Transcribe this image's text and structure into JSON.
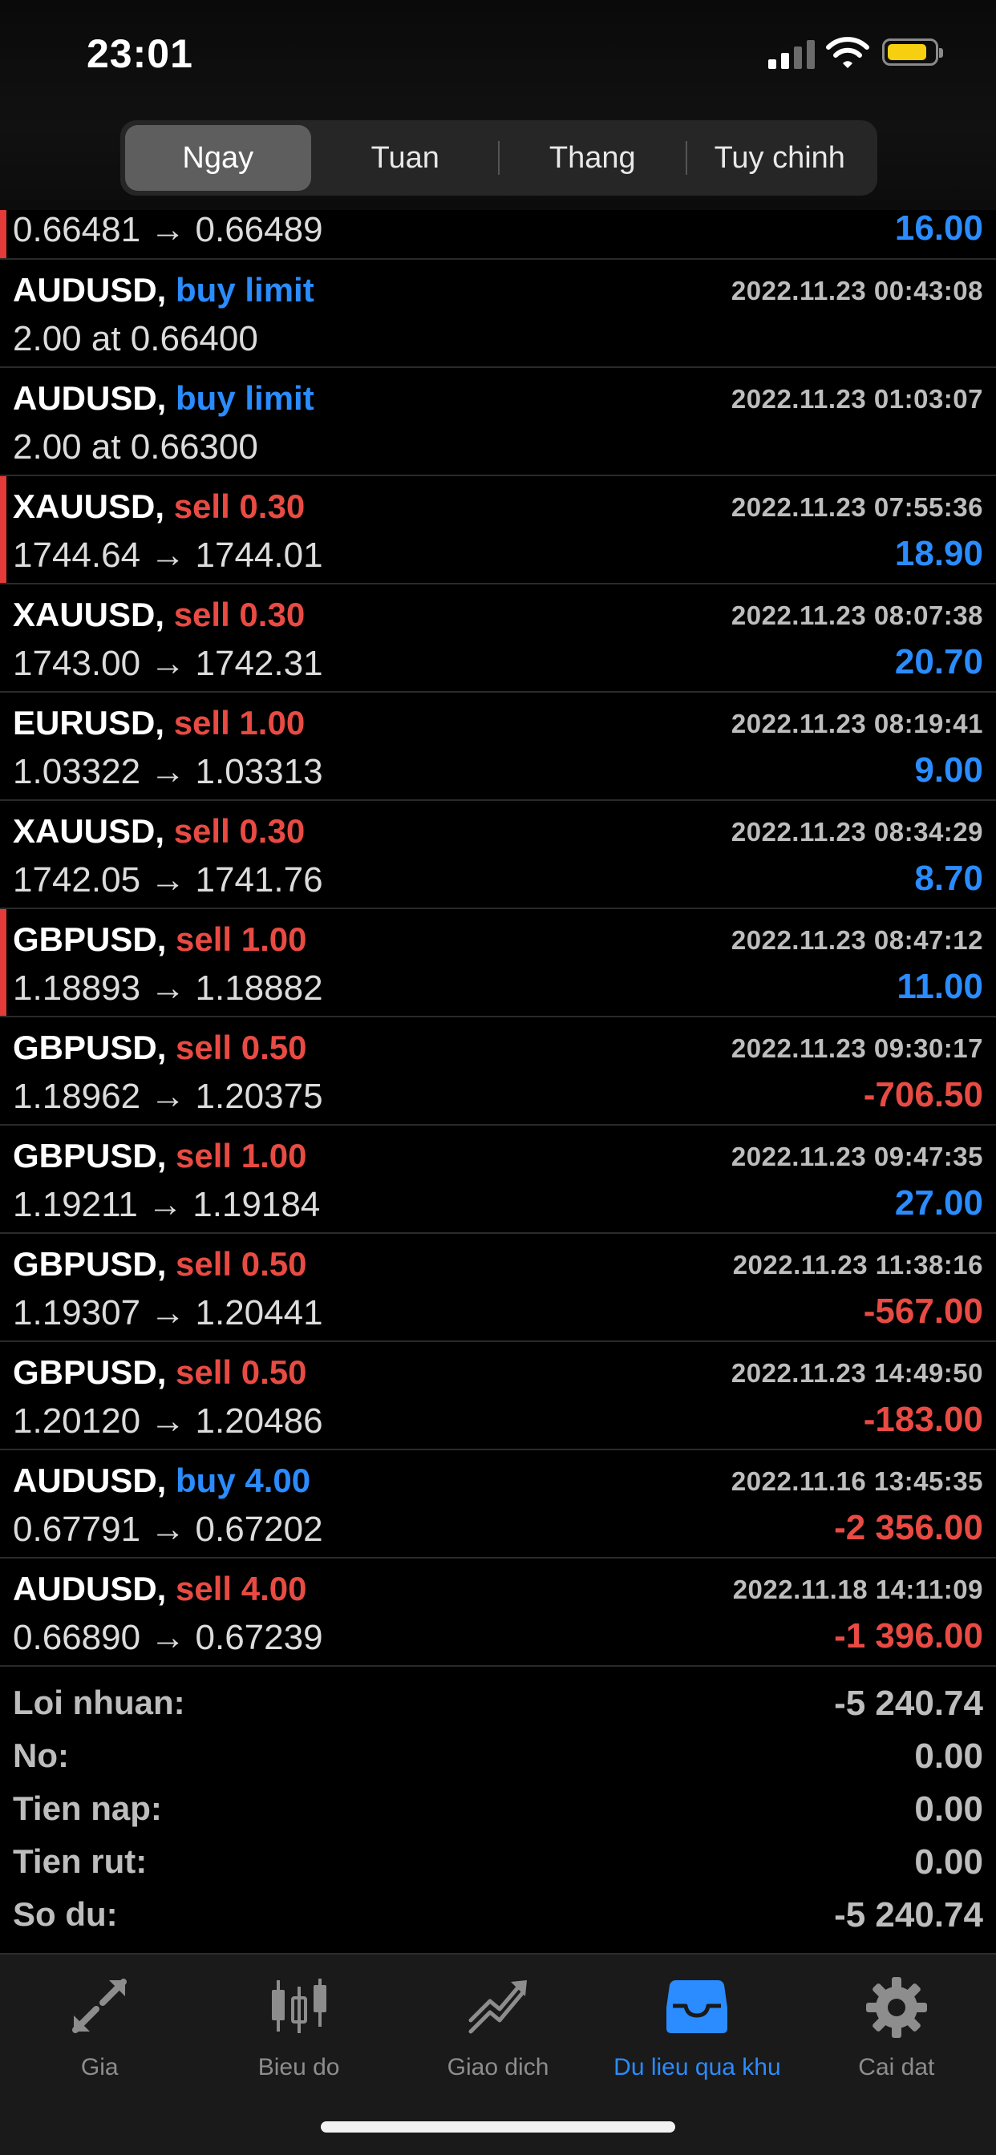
{
  "status_bar": {
    "time": "23:01",
    "battery_color": "#f6d010"
  },
  "segmented": {
    "items": [
      "Ngay",
      "Tuan",
      "Thang",
      "Tuy chinh"
    ],
    "selected": "Ngay"
  },
  "colors": {
    "buy": "#2a8cff",
    "sell": "#e84b43",
    "positive": "#2a8cff",
    "negative": "#e84b43",
    "marker": "#e33a3a"
  },
  "partial_row": {
    "prices": "0.66481 → 0.66489",
    "profit": "16.00"
  },
  "deals": [
    {
      "symbol": "AUDUSD,",
      "type": "buy limit",
      "side": "buy",
      "datetime": "2022.11.23 00:43:08",
      "prices": "2.00 at 0.66400",
      "profit": "",
      "marker": false
    },
    {
      "symbol": "AUDUSD,",
      "type": "buy limit",
      "side": "buy",
      "datetime": "2022.11.23 01:03:07",
      "prices": "2.00 at 0.66300",
      "profit": "",
      "marker": false
    },
    {
      "symbol": "XAUUSD,",
      "type": "sell 0.30",
      "side": "sell",
      "datetime": "2022.11.23 07:55:36",
      "prices": "1744.64 → 1744.01",
      "profit": "18.90",
      "marker": true
    },
    {
      "symbol": "XAUUSD,",
      "type": "sell 0.30",
      "side": "sell",
      "datetime": "2022.11.23 08:07:38",
      "prices": "1743.00 → 1742.31",
      "profit": "20.70",
      "marker": false
    },
    {
      "symbol": "EURUSD,",
      "type": "sell 1.00",
      "side": "sell",
      "datetime": "2022.11.23 08:19:41",
      "prices": "1.03322 → 1.03313",
      "profit": "9.00",
      "marker": false
    },
    {
      "symbol": "XAUUSD,",
      "type": "sell 0.30",
      "side": "sell",
      "datetime": "2022.11.23 08:34:29",
      "prices": "1742.05 → 1741.76",
      "profit": "8.70",
      "marker": false
    },
    {
      "symbol": "GBPUSD,",
      "type": "sell 1.00",
      "side": "sell",
      "datetime": "2022.11.23 08:47:12",
      "prices": "1.18893 → 1.18882",
      "profit": "11.00",
      "marker": true
    },
    {
      "symbol": "GBPUSD,",
      "type": "sell 0.50",
      "side": "sell",
      "datetime": "2022.11.23 09:30:17",
      "prices": "1.18962 → 1.20375",
      "profit": "-706.50",
      "marker": false
    },
    {
      "symbol": "GBPUSD,",
      "type": "sell 1.00",
      "side": "sell",
      "datetime": "2022.11.23 09:47:35",
      "prices": "1.19211 → 1.19184",
      "profit": "27.00",
      "marker": false
    },
    {
      "symbol": "GBPUSD,",
      "type": "sell 0.50",
      "side": "sell",
      "datetime": "2022.11.23 11:38:16",
      "prices": "1.19307 → 1.20441",
      "profit": "-567.00",
      "marker": false
    },
    {
      "symbol": "GBPUSD,",
      "type": "sell 0.50",
      "side": "sell",
      "datetime": "2022.11.23 14:49:50",
      "prices": "1.20120 → 1.20486",
      "profit": "-183.00",
      "marker": false
    },
    {
      "symbol": "AUDUSD,",
      "type": "buy 4.00",
      "side": "buy",
      "datetime": "2022.11.16 13:45:35",
      "prices": "0.67791 → 0.67202",
      "profit": "-2 356.00",
      "marker": false
    },
    {
      "symbol": "AUDUSD,",
      "type": "sell 4.00",
      "side": "sell",
      "datetime": "2022.11.18 14:11:09",
      "prices": "0.66890 → 0.67239",
      "profit": "-1 396.00",
      "marker": false
    }
  ],
  "summary": {
    "profit_label": "Loi nhuan:",
    "profit_value": "-5 240.74",
    "credit_label": "No:",
    "credit_value": "0.00",
    "deposit_label": "Tien nap:",
    "deposit_value": "0.00",
    "withdrawal_label": "Tien rut:",
    "withdrawal_value": "0.00",
    "balance_label": "So du:",
    "balance_value": "-5 240.74"
  },
  "tabbar": {
    "items": [
      {
        "label": "Gia",
        "icon": "arrows-icon"
      },
      {
        "label": "Bieu do",
        "icon": "candlestick-icon"
      },
      {
        "label": "Giao dich",
        "icon": "trend-icon"
      },
      {
        "label": "Du lieu qua khu",
        "icon": "inbox-icon"
      },
      {
        "label": "Cai dat",
        "icon": "gear-icon"
      }
    ],
    "active": "Du lieu qua khu"
  }
}
